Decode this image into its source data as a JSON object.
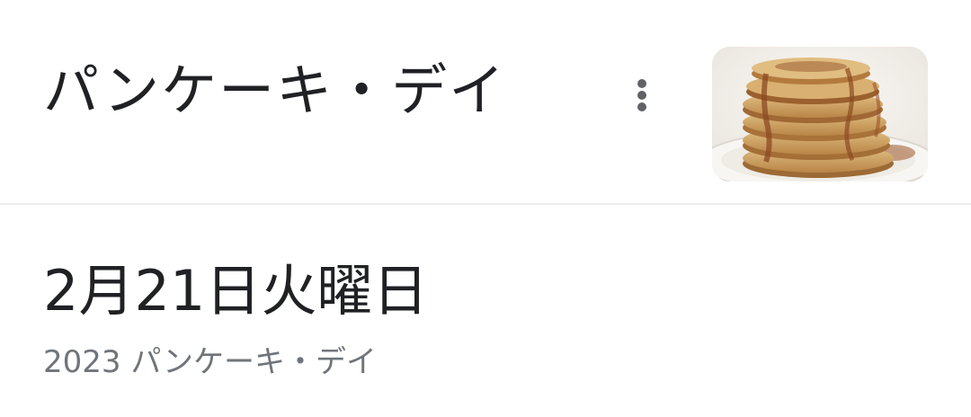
{
  "header": {
    "title": "パンケーキ・デイ",
    "more_icon": "more-vert-icon",
    "thumbnail": "pancake-stack-image"
  },
  "details": {
    "date": "2月21日火曜日",
    "subtitle": "2023 パンケーキ・デイ"
  },
  "colors": {
    "title_text": "#202124",
    "subtitle_text": "#70757a",
    "icon": "#5f6368",
    "divider": "#ebebeb"
  }
}
